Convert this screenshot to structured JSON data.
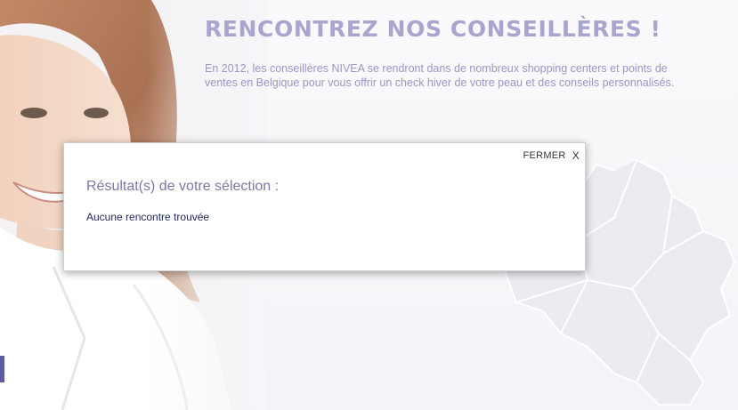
{
  "hero": {
    "title": "RENCONTREZ NOS CONSEILLÈRES !",
    "description": "En 2012, les conseillères NIVEA se rendront dans de nombreux shopping centers et points de ventes en Belgique pour vous offrir un check hiver de votre peau et des conseils personnalisés."
  },
  "modal": {
    "close_label": "FERMER",
    "close_icon_glyph": "X",
    "title": "Résultat(s) de votre sélection :",
    "message": "Aucune rencontre trouvée"
  },
  "colors": {
    "accent": "#a8a5cf",
    "text_accent": "#9b97c6",
    "modal_title": "#7a78a5",
    "modal_message": "#1b2c5a"
  }
}
